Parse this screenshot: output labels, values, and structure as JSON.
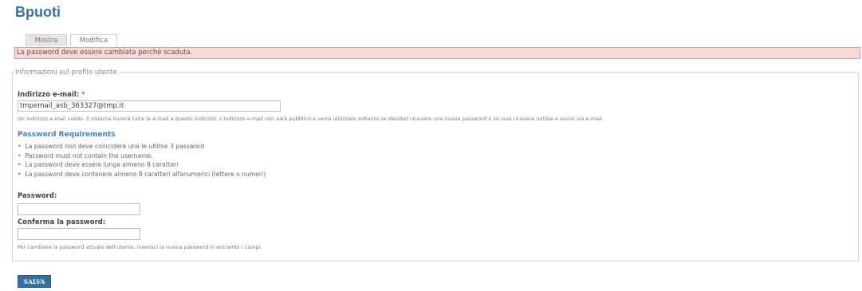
{
  "page_title": "Bpuoti",
  "tabs": [
    {
      "label": "Mostra",
      "active": false
    },
    {
      "label": "Modifica",
      "active": true
    }
  ],
  "error_message": "La password deve essere cambiata perchè scaduta.",
  "fieldset": {
    "legend": "Informazioni sul profilo utente",
    "email": {
      "label": "Indirizzo e-mail:",
      "required_marker": "*",
      "value": "tmpemail_asb_363327@tmp.it",
      "description": "Un indirizzo e-mail valido. Il sistema invierà tutte le e-mail a questo indirizzo. L'indirizzo e-mail non sarà pubblico e verrà utilizzato soltanto se desideri ricevere una nuova password o se vuoi ricevere notizie e avvisi via e-mail."
    },
    "requirements": {
      "title": "Password Requirements",
      "items": [
        "La password non deve coincidere una le ultime 3 password",
        "Password must not contain the username.",
        "La password deve essere lunga almeno 8 caratteri",
        "La password deve contenere almeno 8 caratteri alfanumerici (lettere o numeri)"
      ]
    },
    "password": {
      "label": "Password:",
      "value": ""
    },
    "confirm_password": {
      "label": "Conferma la password:",
      "value": "",
      "description": "Per cambiare la password attuale dell'utente, inserisci la nuova password in entrambi i campi."
    }
  },
  "save_button_label": "SALVA",
  "colors": {
    "title": "#3a72a8",
    "error_bg": "#f9d8d8",
    "error_border": "#e59a9a",
    "requirements_title": "#4a7fb5",
    "button_bg": "#356f9e",
    "required": "#d9534f"
  }
}
